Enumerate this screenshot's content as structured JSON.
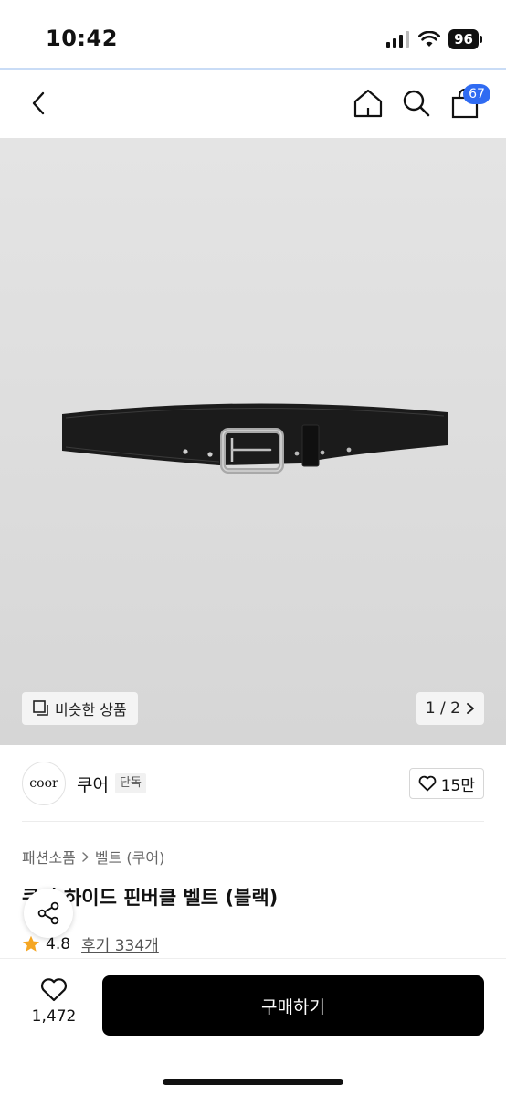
{
  "status_bar": {
    "time": "10:42",
    "battery": "96"
  },
  "header": {
    "cart_count": "67"
  },
  "gallery": {
    "similar_label": "비슷한 상품",
    "pager": "1 / 2"
  },
  "brand": {
    "logo_text": "coor",
    "name": "쿠어",
    "tag": "단독",
    "likes": "15만"
  },
  "breadcrumb": {
    "items": [
      "패션소품",
      "벨트 (쿠어)"
    ]
  },
  "product": {
    "title": "쿠어 하이드 핀버클 벨트 (블랙)",
    "rating": "4.8",
    "reviews": "후기 334개"
  },
  "bottom_bar": {
    "wish_count": "1,472",
    "buy_label": "구매하기"
  },
  "colors": {
    "accent": "#2f6bf2",
    "star": "#f5a623",
    "buy_button": "#000000"
  }
}
